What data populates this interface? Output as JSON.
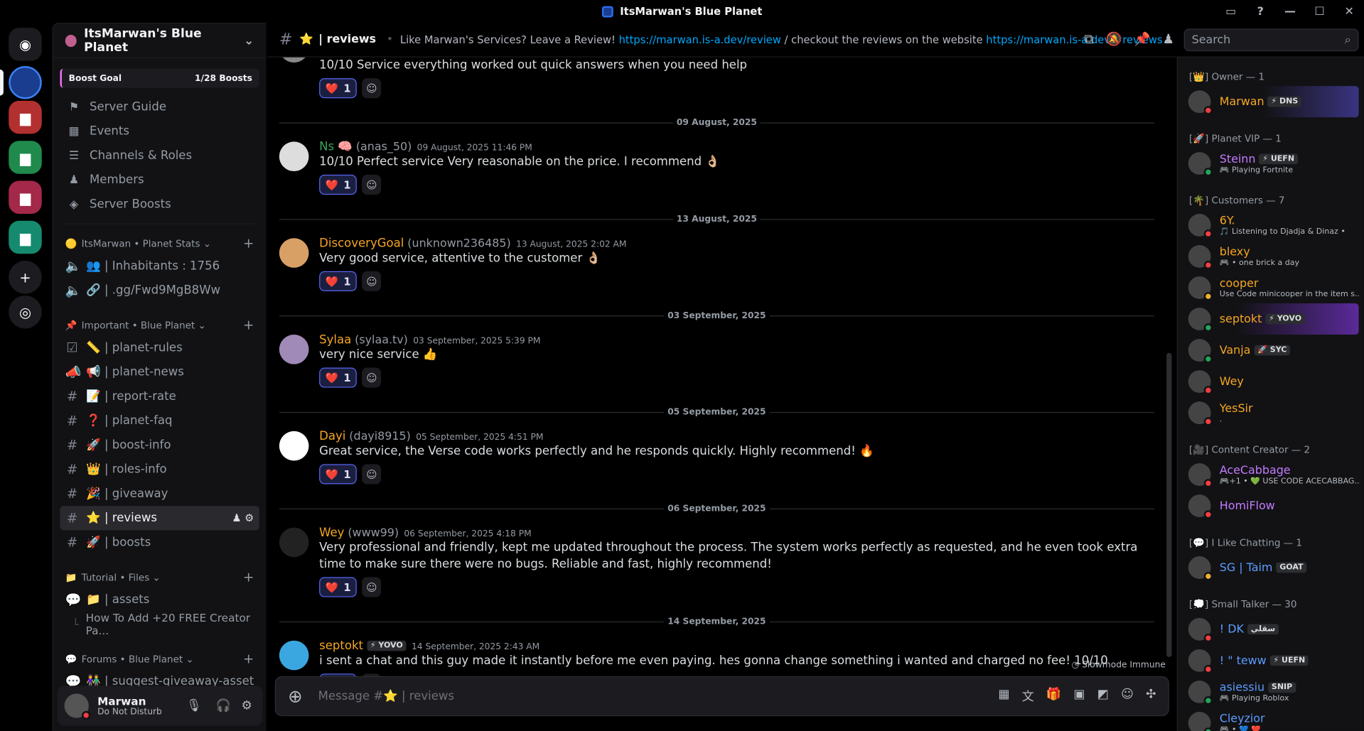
{
  "window": {
    "title": "ItsMarwan's Blue Planet"
  },
  "server": {
    "name": "ItsMarwan's Blue Planet",
    "boost_label": "Boost Goal",
    "boost_count": "1/28 Boosts"
  },
  "nav": [
    "Server Guide",
    "Events",
    "Channels & Roles",
    "Members",
    "Server Boosts"
  ],
  "categories": [
    {
      "name": "ItsMarwan • Planet Stats",
      "channels": [
        "👥 | Inhabitants : 1756",
        "🔗 | .gg/Fwd9MgB8Ww"
      ]
    },
    {
      "name": "Important • Blue Planet",
      "channels": [
        "📏 | planet-rules",
        "📢 | planet-news",
        "📝 | report-rate",
        "❓ | planet-faq",
        "🚀 | boost-info",
        "👑 | roles-info",
        "🎉 | giveaway",
        "⭐ | reviews",
        "🚀 | boosts"
      ]
    },
    {
      "name": "Tutorial • Files",
      "channels": [
        "📁 | assets",
        "How To Add +20 FREE Creator Pa..."
      ]
    },
    {
      "name": "Forums • Blue Planet",
      "channels": [
        "👫 | suggest-giveaway-asset"
      ]
    }
  ],
  "user": {
    "name": "Marwan",
    "status": "Do Not Disturb"
  },
  "channel": {
    "name": "| reviews",
    "topic_pre": "Like Marwan's Services? Leave a Review!",
    "link1": "https://marwan.is-a.dev/review",
    "topic_mid": "/ checkout the reviews on the website",
    "link2": "https://marwan.is-a.dev/#reviews"
  },
  "search": {
    "placeholder": "Search"
  },
  "messages": [
    {
      "date": "",
      "user": "",
      "handle": "",
      "time": "",
      "text": "10/10 Service everything worked out quick answers when you need help",
      "react": "1"
    },
    {
      "date": "09 August, 2025",
      "user": "Ns 🧠",
      "handle": "(anas_50)",
      "time": "09 August, 2025 11:46 PM",
      "text": "10/10 Perfect service Very reasonable on the price. I recommend 👌🏼",
      "react": "1"
    },
    {
      "date": "13 August, 2025",
      "user": "DiscoveryGoal",
      "handle": "(unknown236485)",
      "time": "13 August, 2025 2:02 AM",
      "text": "Very good service, attentive to the customer 👌🏼",
      "react": "1"
    },
    {
      "date": "03 September, 2025",
      "user": "Sylaa",
      "handle": "(sylaa.tv)",
      "time": "03 September, 2025 5:39 PM",
      "text": "very nice service 👍",
      "react": "1"
    },
    {
      "date": "05 September, 2025",
      "user": "Dayi",
      "handle": "(dayi8915)",
      "time": "05 September, 2025 4:51 PM",
      "text": "Great service, the Verse code works perfectly and he responds quickly. Highly recommend! 🔥",
      "react": "1"
    },
    {
      "date": "06 September, 2025",
      "user": "Wey",
      "handle": "(www99)",
      "time": "06 September, 2025 4:18 PM",
      "text": "Very professional and friendly, kept me updated throughout the process. The system works perfectly as requested, and he even took extra time to make sure there were no bugs. Reliable and fast, highly recommend!",
      "react": "1"
    },
    {
      "date": "14 September, 2025",
      "user": "septokt",
      "tag": "⚡ YOVO",
      "handle": "",
      "time": "14 September, 2025 2:43 AM",
      "text": "i sent a chat and this guy made it instantly before me even paying. hes gonna change something i wanted and charged no fee! 10/10",
      "react": "1"
    }
  ],
  "slowmode": "Slowmode Immune",
  "composer": {
    "placeholder": "Message #⭐ | reviews"
  },
  "member_groups": [
    {
      "title": "[👑] Owner — 1",
      "members": [
        {
          "name": "Marwan",
          "tag": "⚡ DNS",
          "act": ""
        }
      ]
    },
    {
      "title": "[🚀] Planet VIP — 1",
      "members": [
        {
          "name": "Steinn",
          "tag": "⚡ UEFN",
          "act": "🎮 Playing Fortnite",
          "color": "#c27bff"
        }
      ]
    },
    {
      "title": "[🌴] Customers — 7",
      "members": [
        {
          "name": "6Y.",
          "tag": "",
          "act": "🎵 Listening to Djadja & Dinaz •"
        },
        {
          "name": "blexy",
          "tag": "",
          "act": "🎮 • one brick a day"
        },
        {
          "name": "cooper",
          "tag": "",
          "act": "Use Code minicooper in the item s..."
        },
        {
          "name": "septokt",
          "tag": "⚡ YOVO",
          "act": ""
        },
        {
          "name": "Vanja",
          "tag": "🚀 SYC",
          "act": ""
        },
        {
          "name": "Wey",
          "tag": "",
          "act": ""
        },
        {
          "name": "YesSir",
          "tag": "",
          "act": "."
        }
      ]
    },
    {
      "title": "[🎥] Content Creator — 2",
      "members": [
        {
          "name": "AceCabbage",
          "tag": "",
          "act": "🎮+1 • 💚 USE CODE ACECABBAG...",
          "color": "#c27bff"
        },
        {
          "name": "HomiFlow",
          "tag": "",
          "act": "",
          "color": "#c27bff"
        }
      ]
    },
    {
      "title": "[💬] I Like Chatting — 1",
      "members": [
        {
          "name": "SG | Taim",
          "tag": "GOAT",
          "act": "",
          "color": "#5b9cff"
        }
      ]
    },
    {
      "title": "[💭] Small Talker — 30",
      "members": [
        {
          "name": "! DK",
          "tag": "سقلي",
          "act": "",
          "color": "#5b9cff"
        },
        {
          "name": "! \" teww",
          "tag": "⚡ UEFN",
          "act": "",
          "color": "#5b9cff"
        },
        {
          "name": "asiessiu",
          "tag": "SNIP",
          "act": "🎮 Playing Roblox",
          "color": "#5b9cff"
        },
        {
          "name": "Cleyzior",
          "tag": "",
          "act": "🎮 • 💙 ❤️",
          "color": "#5b9cff"
        }
      ]
    }
  ]
}
